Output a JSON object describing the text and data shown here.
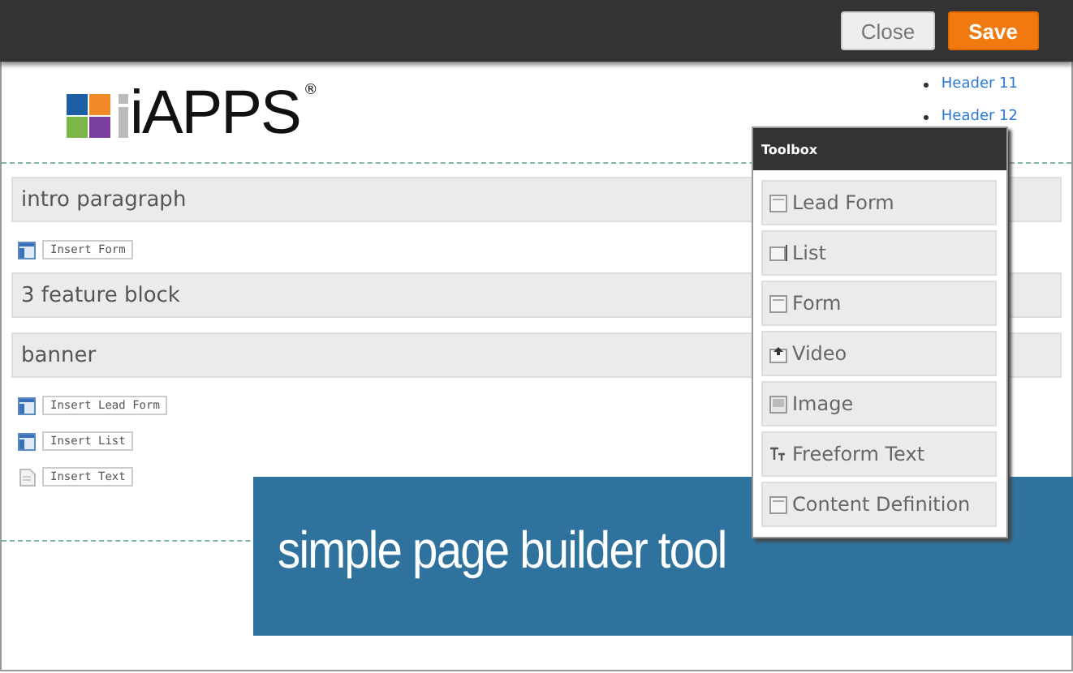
{
  "topbar": {
    "buttons": [
      {
        "label": "Close",
        "kind": "secondary"
      },
      {
        "label": "Save",
        "kind": "primary"
      }
    ]
  },
  "logo": {
    "text": "iAPPS",
    "mark": "®"
  },
  "header_links": [
    "Header 11",
    "Header 12"
  ],
  "blocks": [
    {
      "kind": "section",
      "label": "intro paragraph"
    },
    {
      "kind": "widget",
      "label": "Insert Form"
    },
    {
      "kind": "section",
      "label": "3 feature block"
    },
    {
      "kind": "section",
      "label": "banner"
    },
    {
      "kind": "widget",
      "label": "Insert Lead Form"
    },
    {
      "kind": "widget",
      "label": "Insert List"
    },
    {
      "kind": "text",
      "label": "Insert Text"
    }
  ],
  "toolbox": {
    "title": "Toolbox",
    "items": [
      {
        "label": "Lead Form"
      },
      {
        "label": "List"
      },
      {
        "label": "Form"
      },
      {
        "label": "Video"
      },
      {
        "label": "Image"
      },
      {
        "label": "Freeform Text"
      },
      {
        "label": "Content Definition"
      }
    ]
  },
  "caption": "simple page builder tool"
}
